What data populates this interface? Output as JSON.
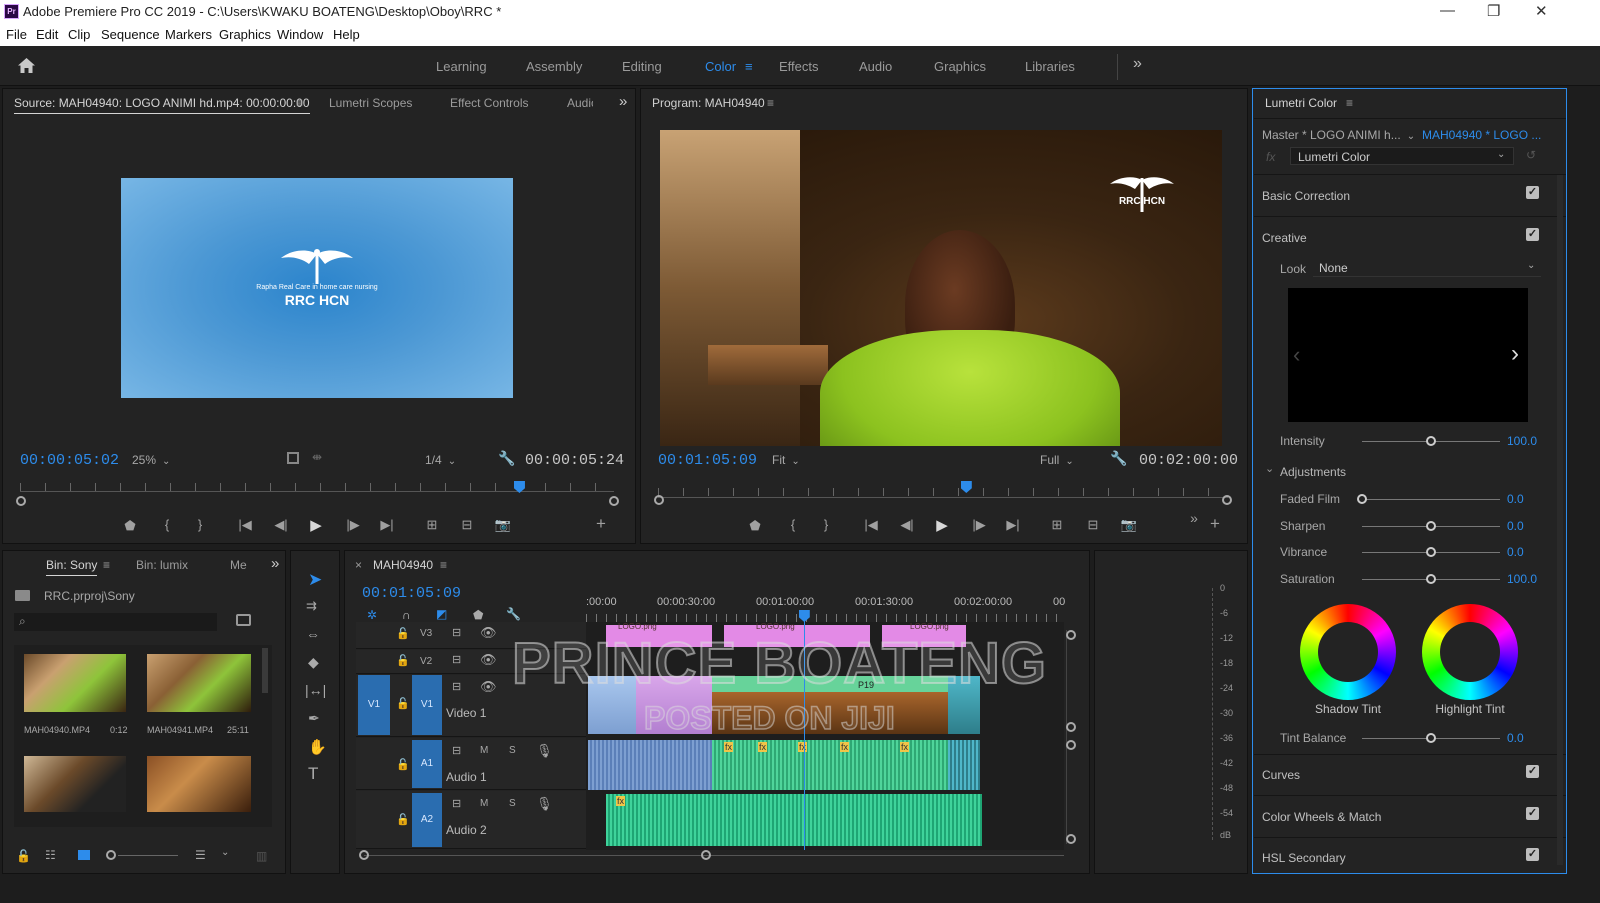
{
  "window": {
    "title": "Adobe Premiere Pro CC 2019 - C:\\Users\\KWAKU BOATENG\\Desktop\\Oboy\\RRC *",
    "app_badge": "Pr",
    "controls": {
      "minimize": "—",
      "maximize": "❐",
      "close": "✕"
    }
  },
  "menu": [
    "File",
    "Edit",
    "Clip",
    "Sequence",
    "Markers",
    "Graphics",
    "Window",
    "Help"
  ],
  "workspaces": {
    "items": [
      "Learning",
      "Assembly",
      "Editing",
      "Color",
      "Effects",
      "Audio",
      "Graphics",
      "Libraries"
    ],
    "active": "Color",
    "overflow": "»"
  },
  "source_panel": {
    "tabs": [
      "Source: MAH04940: LOGO ANIMI hd.mp4: 00:00:00:00",
      "Lumetri Scopes",
      "Effect Controls",
      "Audio"
    ],
    "overflow": "»",
    "timecode_in": "00:00:05:02",
    "zoom": "25%",
    "resolution": "1/4",
    "duration": "00:00:05:24",
    "playhead_fraction": 0.84,
    "logo_caption": "Rapha Real Care in home care nursing",
    "logo_text": "RRC HCN"
  },
  "program_panel": {
    "tab": "Program: MAH04940",
    "timecode": "00:01:05:09",
    "fit": "Fit",
    "resolution": "Full",
    "duration": "00:02:00:00",
    "playhead_fraction": 0.54,
    "overlay_logo": "RRC HCN",
    "overflow": "»"
  },
  "lumetri": {
    "title": "Lumetri Color",
    "master_clip": "Master * LOGO ANIMI h...",
    "sequence_clip": "MAH04940 * LOGO ...",
    "effect": "Lumetri Color",
    "fx_label": "fx",
    "sections": {
      "basic_correction": "Basic Correction",
      "creative": "Creative",
      "curves": "Curves",
      "color_wheels": "Color Wheels & Match",
      "hsl": "HSL Secondary"
    },
    "look_label": "Look",
    "look_value": "None",
    "intensity": {
      "label": "Intensity",
      "value": "100.0",
      "fraction": 0.5
    },
    "adjustments_label": "Adjustments",
    "sliders": [
      {
        "label": "Faded Film",
        "value": "0.0",
        "fraction": 0.0
      },
      {
        "label": "Sharpen",
        "value": "0.0",
        "fraction": 0.5
      },
      {
        "label": "Vibrance",
        "value": "0.0",
        "fraction": 0.5
      },
      {
        "label": "Saturation",
        "value": "100.0",
        "fraction": 0.5
      }
    ],
    "shadow_tint": "Shadow Tint",
    "highlight_tint": "Highlight Tint",
    "tint_balance": {
      "label": "Tint Balance",
      "value": "0.0",
      "fraction": 0.5
    }
  },
  "project_panel": {
    "tabs": [
      "Bin: Sony",
      "Bin: lumix",
      "Me"
    ],
    "overflow": "»",
    "path": "RRC.prproj\\Sony",
    "search_placeholder": "",
    "items": [
      {
        "name": "MAH04940.MP4",
        "duration": "0:12"
      },
      {
        "name": "MAH04941.MP4",
        "duration": "25:11"
      },
      {
        "name": "",
        "duration": ""
      },
      {
        "name": "",
        "duration": ""
      }
    ]
  },
  "timeline": {
    "tab": "MAH04940",
    "close": "×",
    "timecode": "00:01:05:09",
    "ruler": [
      ":00:00",
      "00:00:30:00",
      "00:01:00:00",
      "00:01:30:00",
      "00:02:00:00",
      "00"
    ],
    "tracks": [
      {
        "id": "V3",
        "name": ""
      },
      {
        "id": "V2",
        "name": ""
      },
      {
        "id": "V1",
        "name": "Video 1",
        "source": "V1"
      },
      {
        "id": "A1",
        "name": "Audio 1",
        "m": "M",
        "s": "S"
      },
      {
        "id": "A2",
        "name": "Audio 2",
        "m": "M",
        "s": "S"
      }
    ],
    "clip_labels": {
      "logo": "LOGO.png",
      "p19": "P19",
      "fx": "fx"
    },
    "watermark_1": "PRINCE BOATENG",
    "watermark_2": "POSTED ON JIJI",
    "playhead_fraction": 0.55
  },
  "audio_meter": {
    "ticks": [
      "0",
      "-6",
      "-12",
      "-18",
      "-24",
      "-30",
      "-36",
      "-42",
      "-48",
      "-54",
      "dB"
    ]
  }
}
